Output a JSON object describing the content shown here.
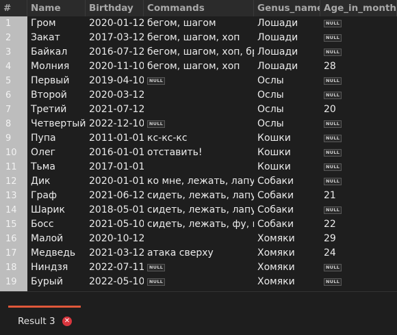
{
  "table": {
    "columns": [
      "#",
      "Name",
      "Birthday",
      "Commands",
      "Genus_name",
      "Age_in_month"
    ],
    "null_label": "NULL",
    "rows": [
      [
        "1",
        "Гром",
        "2020-01-12",
        "бегом, шагом",
        "Лошади",
        null
      ],
      [
        "2",
        "Закат",
        "2017-03-12",
        "бегом, шагом, хоп",
        "Лошади",
        null
      ],
      [
        "3",
        "Байкал",
        "2016-07-12",
        "бегом, шагом, хоп, брр",
        "Лошади",
        null
      ],
      [
        "4",
        "Молния",
        "2020-11-10",
        "бегом, шагом, хоп",
        "Лошади",
        "28"
      ],
      [
        "5",
        "Первый",
        "2019-04-10",
        null,
        "Ослы",
        null
      ],
      [
        "6",
        "Второй",
        "2020-03-12",
        "",
        "Ослы",
        null
      ],
      [
        "7",
        "Третий",
        "2021-07-12",
        "",
        "Ослы",
        "20"
      ],
      [
        "8",
        "Четвертый",
        "2022-12-10",
        null,
        "Ослы",
        null
      ],
      [
        "9",
        "Пупа",
        "2011-01-01",
        "кс-кс-кс",
        "Кошки",
        null
      ],
      [
        "10",
        "Олег",
        "2016-01-01",
        "отставить!",
        "Кошки",
        null
      ],
      [
        "11",
        "Тьма",
        "2017-01-01",
        "",
        "Кошки",
        null
      ],
      [
        "12",
        "Дик",
        "2020-01-01",
        "ко мне, лежать, лапу, голос",
        "Собаки",
        null
      ],
      [
        "13",
        "Граф",
        "2021-06-12",
        "сидеть, лежать, лапу",
        "Собаки",
        "21"
      ],
      [
        "14",
        "Шарик",
        "2018-05-01",
        "сидеть, лежать, лапу, голос",
        "Собаки",
        null
      ],
      [
        "15",
        "Босс",
        "2021-05-10",
        "сидеть, лежать, фу, место",
        "Собаки",
        "22"
      ],
      [
        "16",
        "Малой",
        "2020-10-12",
        "",
        "Хомяки",
        "29"
      ],
      [
        "17",
        "Медведь",
        "2021-03-12",
        "атака сверху",
        "Хомяки",
        "24"
      ],
      [
        "18",
        "Ниндзя",
        "2022-07-11",
        null,
        "Хомяки",
        null
      ],
      [
        "19",
        "Бурый",
        "2022-05-10",
        null,
        "Хомяки",
        null
      ]
    ]
  },
  "result_tab": {
    "label": "Result 3"
  }
}
